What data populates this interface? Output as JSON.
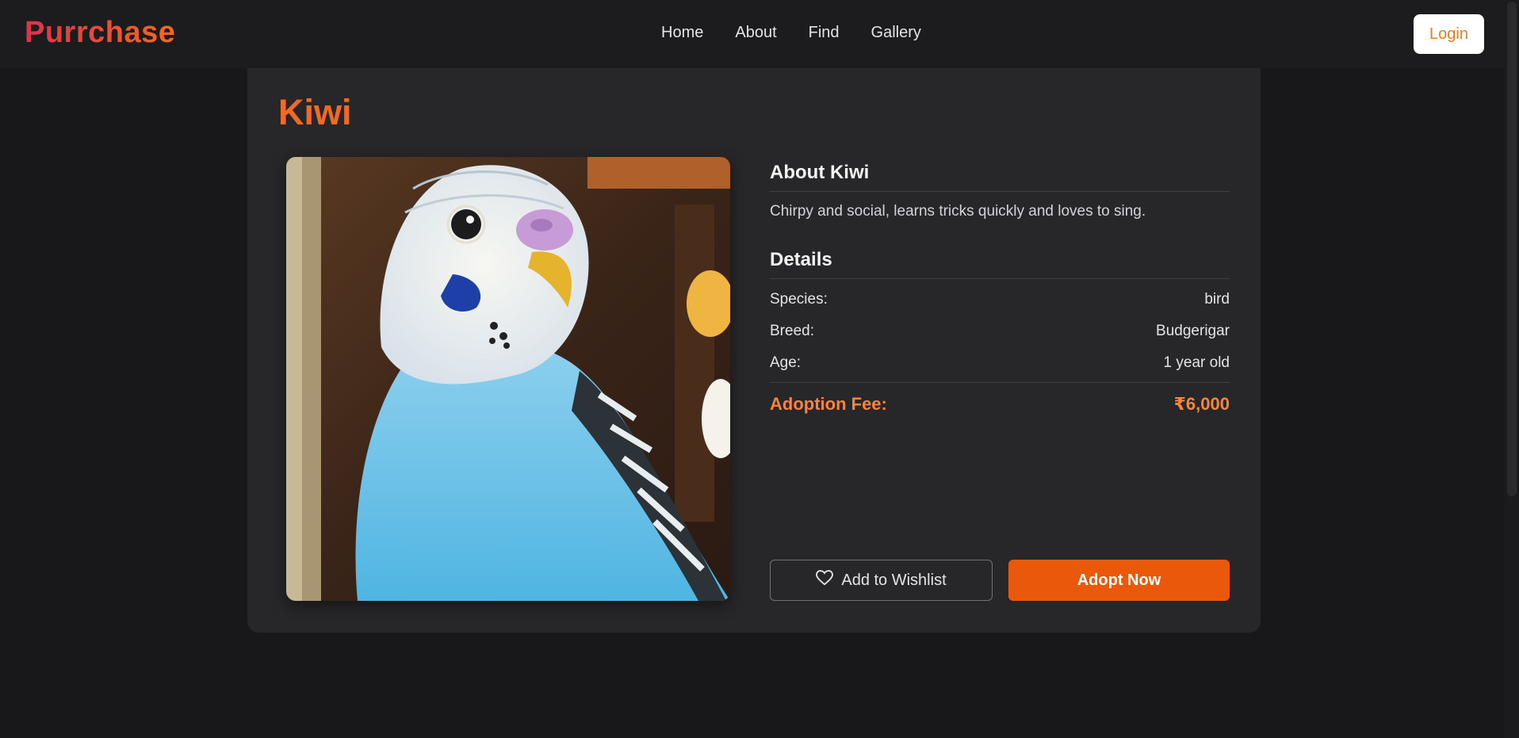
{
  "brand": {
    "logo": "Purrchase"
  },
  "nav": {
    "links": [
      {
        "label": "Home"
      },
      {
        "label": "About"
      },
      {
        "label": "Find"
      },
      {
        "label": "Gallery"
      }
    ],
    "login_label": "Login"
  },
  "pet": {
    "name": "Kiwi",
    "about_title": "About Kiwi",
    "description": "Chirpy and social, learns tricks quickly and loves to sing.",
    "details_title": "Details",
    "details": [
      {
        "label": "Species:",
        "value": "bird"
      },
      {
        "label": "Breed:",
        "value": "Budgerigar"
      },
      {
        "label": "Age:",
        "value": "1 year old"
      }
    ],
    "fee_label": "Adoption Fee:",
    "fee_value": "₹6,000"
  },
  "actions": {
    "wishlist_label": "Add to Wishlist",
    "adopt_label": "Adopt Now"
  },
  "colors": {
    "accent": "#ea580c",
    "title": "#f26a21",
    "background": "#18181b",
    "card": "#27272a"
  },
  "icons": {
    "wishlist": "heart-icon"
  }
}
